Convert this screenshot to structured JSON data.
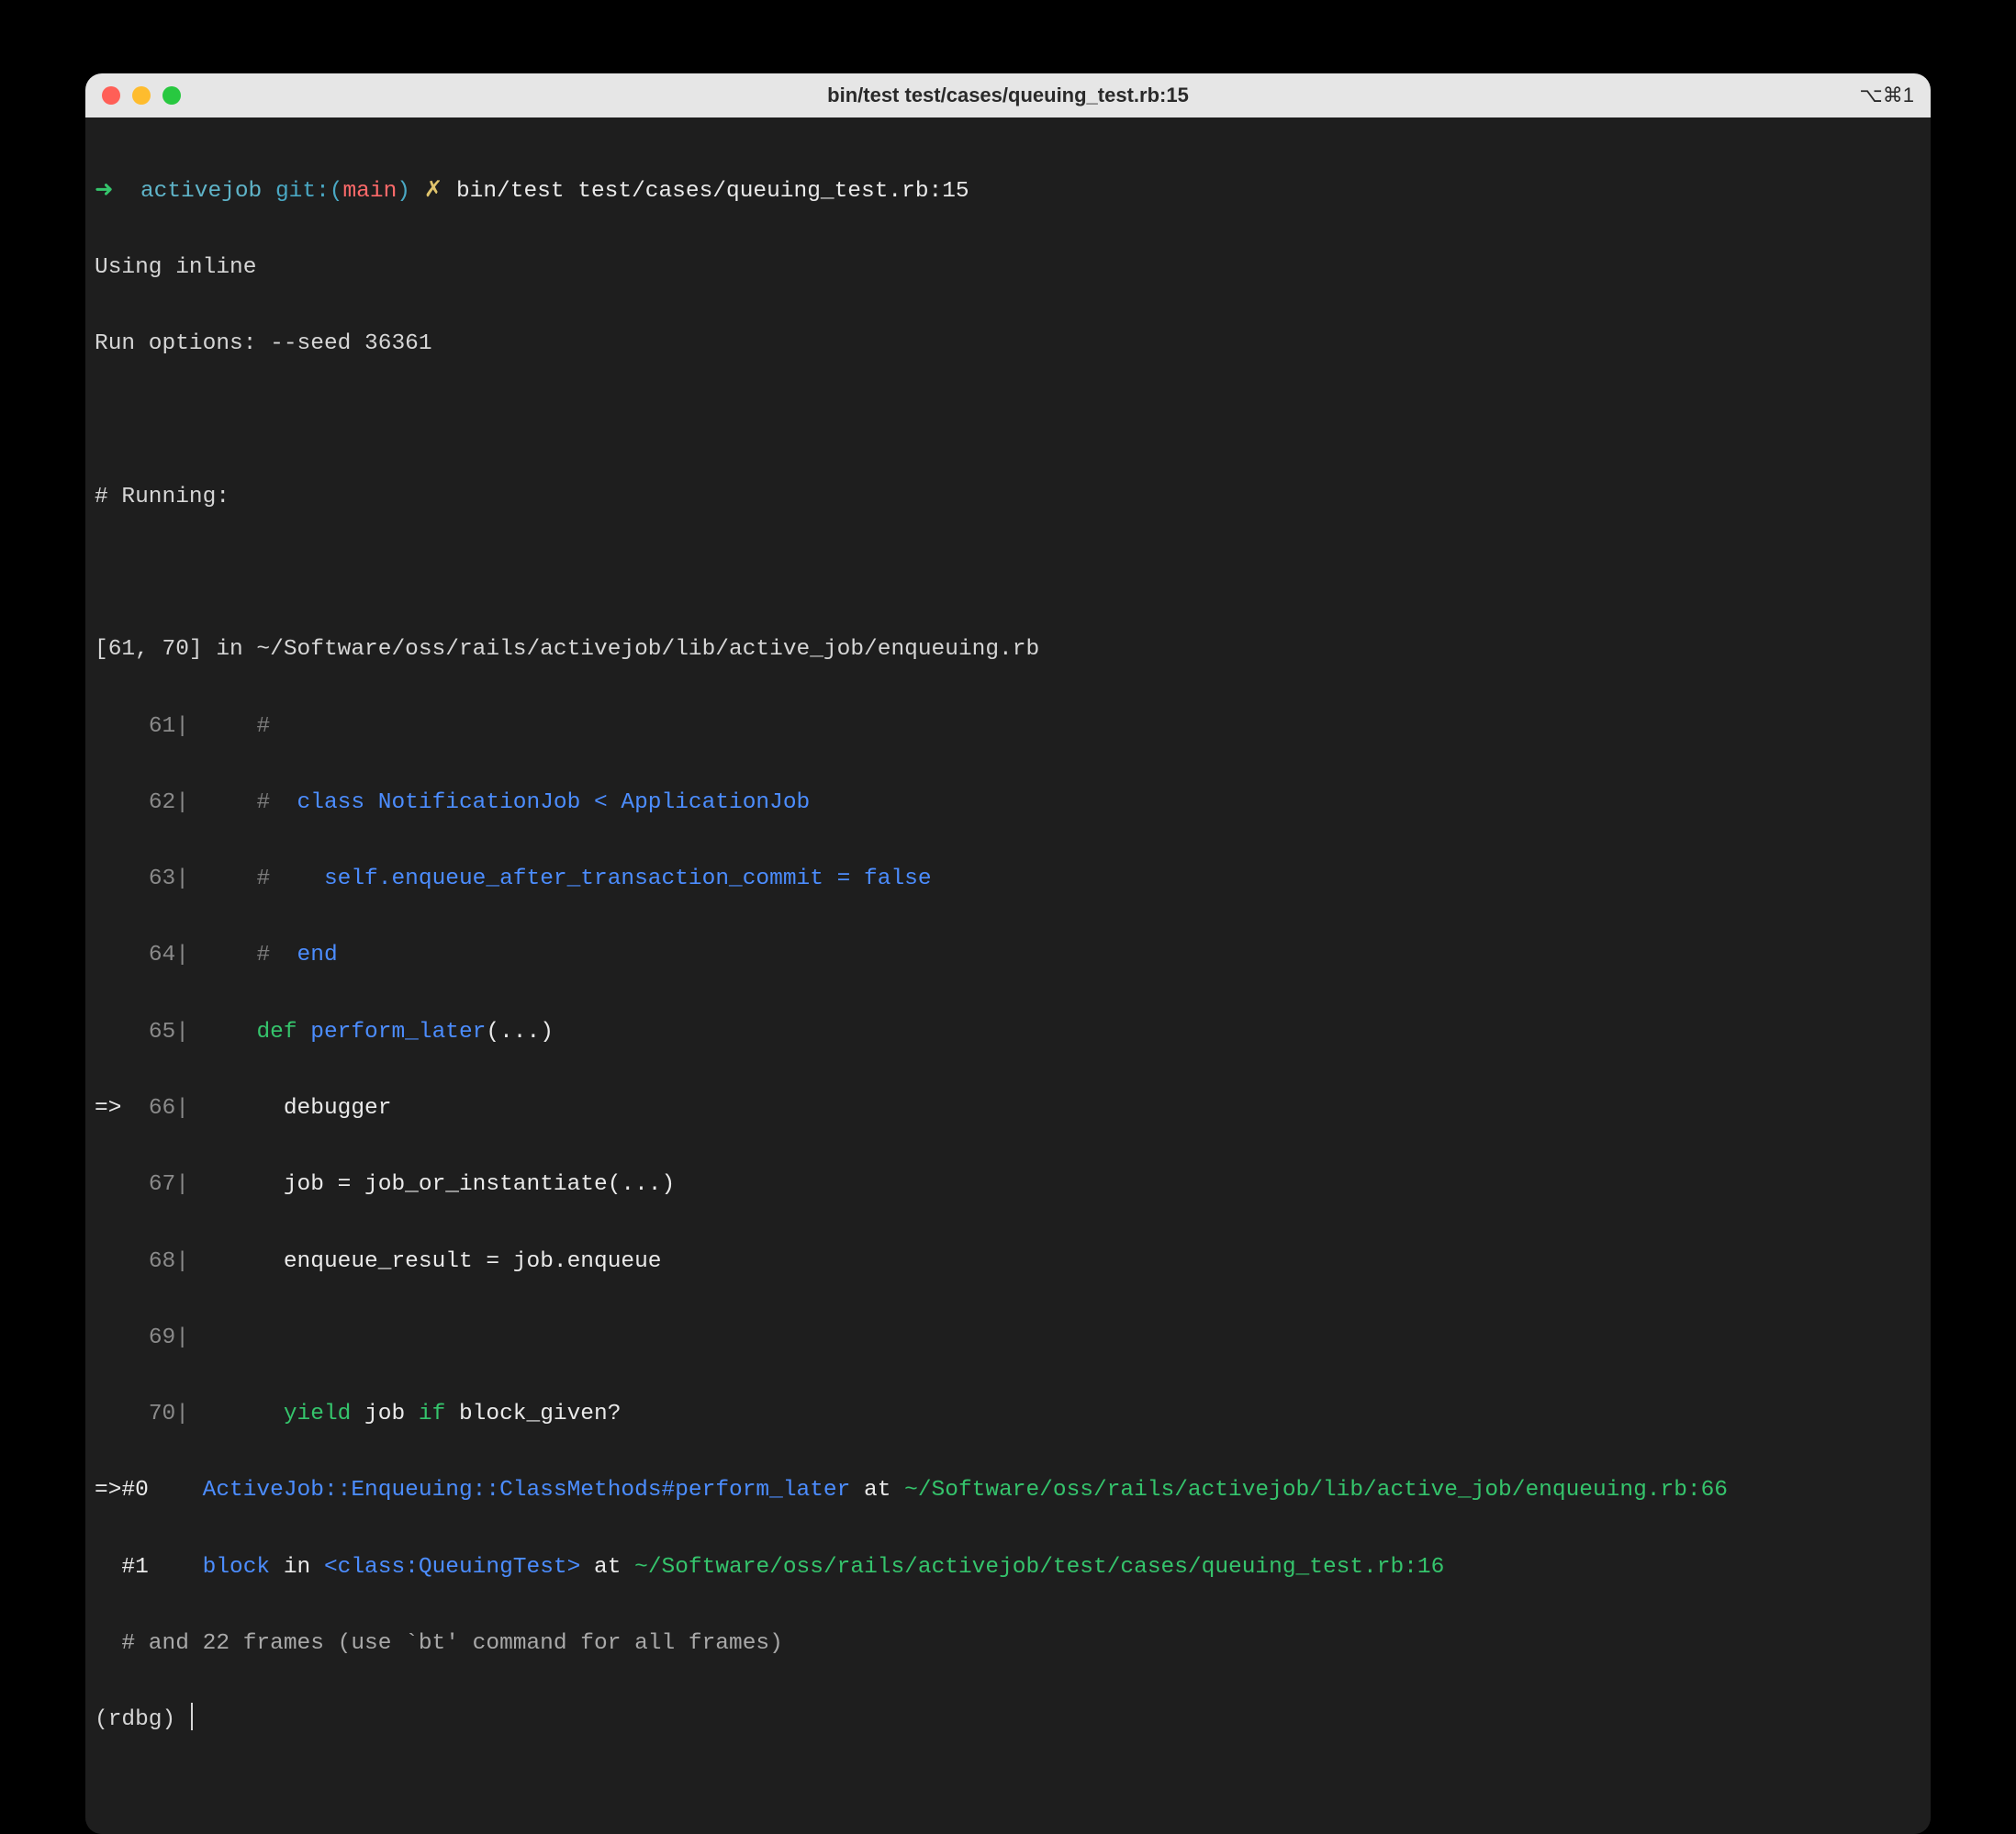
{
  "window": {
    "title": "bin/test test/cases/queuing_test.rb:15",
    "shortcut": "⌥⌘1"
  },
  "prompt": {
    "arrow": "➜",
    "dir": "activejob",
    "git_label": "git:",
    "branch": "main",
    "dirty_marker": "✗",
    "command": "bin/test test/cases/queuing_test.rb:15"
  },
  "output": {
    "using": "Using inline",
    "run_options": "Run options: --seed 36361",
    "running_header": "# Running:",
    "file_range": "[61, 70] in ~/Software/oss/rails/activejob/lib/active_job/enqueuing.rb"
  },
  "source": {
    "marker_current": "=>",
    "lines": [
      {
        "n": "61",
        "hash": "#"
      },
      {
        "n": "62",
        "hash": "#  ",
        "text": "class NotificationJob < ApplicationJob"
      },
      {
        "n": "63",
        "hash": "#    ",
        "text": "self.enqueue_after_transaction_commit = false"
      },
      {
        "n": "64",
        "hash": "#  ",
        "text": "end"
      },
      {
        "n": "65",
        "def": "def",
        "method": "perform_later",
        "args": "(...)"
      },
      {
        "n": "66",
        "body": "debugger"
      },
      {
        "n": "67",
        "body": "job = job_or_instantiate(...)"
      },
      {
        "n": "68",
        "body": "enqueue_result = job.enqueue"
      },
      {
        "n": "69",
        "body": ""
      },
      {
        "n": "70",
        "kw": "yield",
        "rest": " job ",
        "kw2": "if",
        "rest2": " block_given?"
      }
    ]
  },
  "stack": {
    "f0": {
      "marker": "=>#0",
      "klass": "ActiveJob::Enqueuing::ClassMethods#perform_later",
      "at": " at ",
      "path": "~/Software/oss/rails/activejob/lib/active_job/enqueuing.rb:66"
    },
    "f1": {
      "marker": "  #1",
      "block": "block",
      "in": " in ",
      "klass": "<class:QueuingTest>",
      "at": " at ",
      "path": "~/Software/oss/rails/activejob/test/cases/queuing_test.rb:16"
    },
    "more": "  # and 22 frames (use `bt' command for all frames)"
  },
  "rdbg_prompt": "(rdbg) "
}
